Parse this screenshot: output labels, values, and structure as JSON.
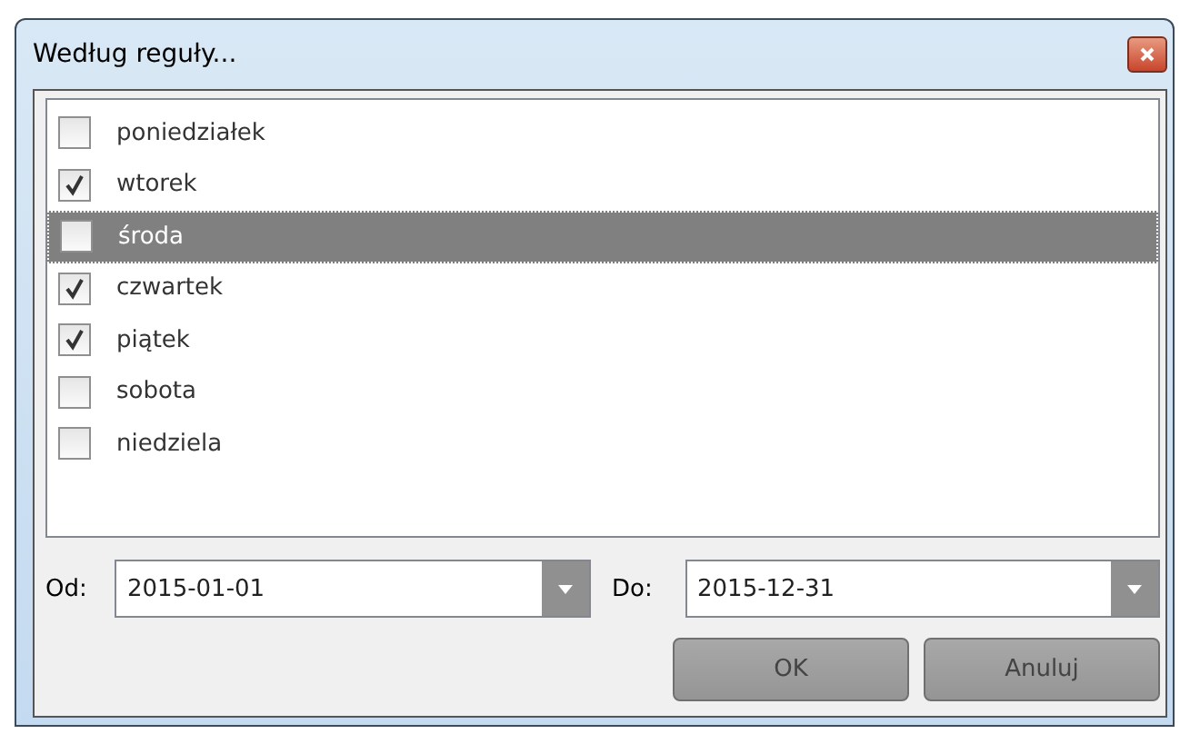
{
  "window": {
    "title": "Według reguły..."
  },
  "days": [
    {
      "label": "poniedziałek",
      "checked": false,
      "selected": false
    },
    {
      "label": "wtorek",
      "checked": true,
      "selected": false
    },
    {
      "label": "środa",
      "checked": false,
      "selected": true
    },
    {
      "label": "czwartek",
      "checked": true,
      "selected": false
    },
    {
      "label": "piątek",
      "checked": true,
      "selected": false
    },
    {
      "label": "sobota",
      "checked": false,
      "selected": false
    },
    {
      "label": "niedziela",
      "checked": false,
      "selected": false
    }
  ],
  "from": {
    "label": "Od:",
    "value": "2015-01-01"
  },
  "to": {
    "label": "Do:",
    "value": "2015-12-31"
  },
  "buttons": [
    "OK",
    "Anuluj"
  ]
}
